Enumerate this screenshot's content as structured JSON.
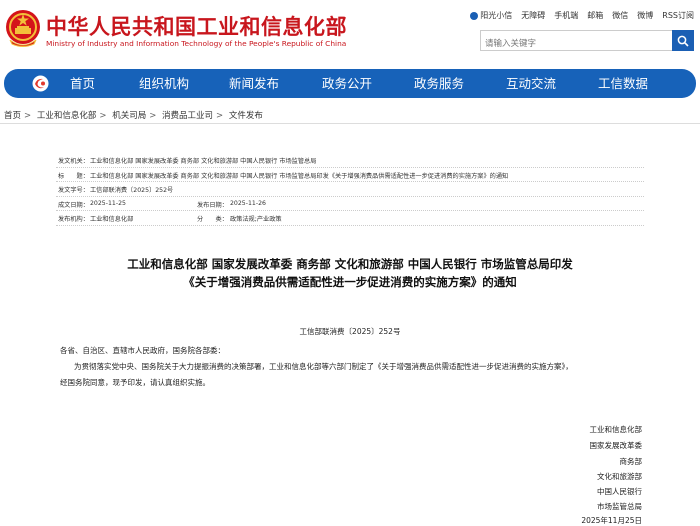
{
  "header": {
    "title_cn": "中华人民共和国工业和信息化部",
    "title_en": "Ministry of Industry and Information Technology of the People's Republic of China",
    "top_links": [
      "阳光小信",
      "无障碍",
      "手机端",
      "邮箱",
      "微信",
      "微博",
      "RSS订阅"
    ],
    "search_placeholder": "请输入关键字"
  },
  "nav": {
    "items": [
      "首页",
      "组织机构",
      "新闻发布",
      "政务公开",
      "政务服务",
      "互动交流",
      "工信数据"
    ]
  },
  "breadcrumb": [
    "首页",
    "工业和信息化部",
    "机关司局",
    "消费品工业司",
    "文件发布"
  ],
  "meta": {
    "issuer_label": "发文机关：",
    "issuer": "工业和信息化部 国家发展改革委 商务部 文化和旅游部 中国人民银行 市场监管总局",
    "title_label": "标　　题：",
    "title": "工业和信息化部 国家发展改革委 商务部 文化和旅游部 中国人民银行 市场监管总局印发《关于增强消费品供需适配性进一步促进消费的实施方案》的通知",
    "docno_label": "发文字号：",
    "docno": "工信部联消费〔2025〕252号",
    "written_label": "成文日期：",
    "written": "2025-11-25",
    "published_label": "发布日期：",
    "published": "2025-11-26",
    "org_label": "发布机构：",
    "org": "工业和信息化部",
    "category_label": "分　　类：",
    "category": "政策法规;产业政策"
  },
  "document": {
    "title_line1": "工业和信息化部 国家发展改革委 商务部 文化和旅游部 中国人民银行 市场监管总局印发",
    "title_line2": "《关于增强消费品供需适配性进一步促进消费的实施方案》的通知",
    "docno": "工信部联消费〔2025〕252号",
    "addressee": "各省、自治区、直辖市人民政府，国务院各部委：",
    "body_line1": "为贯彻落实党中央、国务院关于大力提振消费的决策部署，工业和信息化部等六部门制定了《关于增强消费品供需适配性进一步促进消费的实施方案》，",
    "body_line2": "经国务院同意，现予印发，请认真组织实施。",
    "signatories": [
      "工业和信息化部",
      "国家发展改革委",
      "商务部",
      "文化和旅游部",
      "中国人民银行",
      "市场监管总局"
    ],
    "date": "2025年11月25日"
  },
  "colors": {
    "brand_red": "#c8161d",
    "nav_blue": "#1762b9"
  }
}
